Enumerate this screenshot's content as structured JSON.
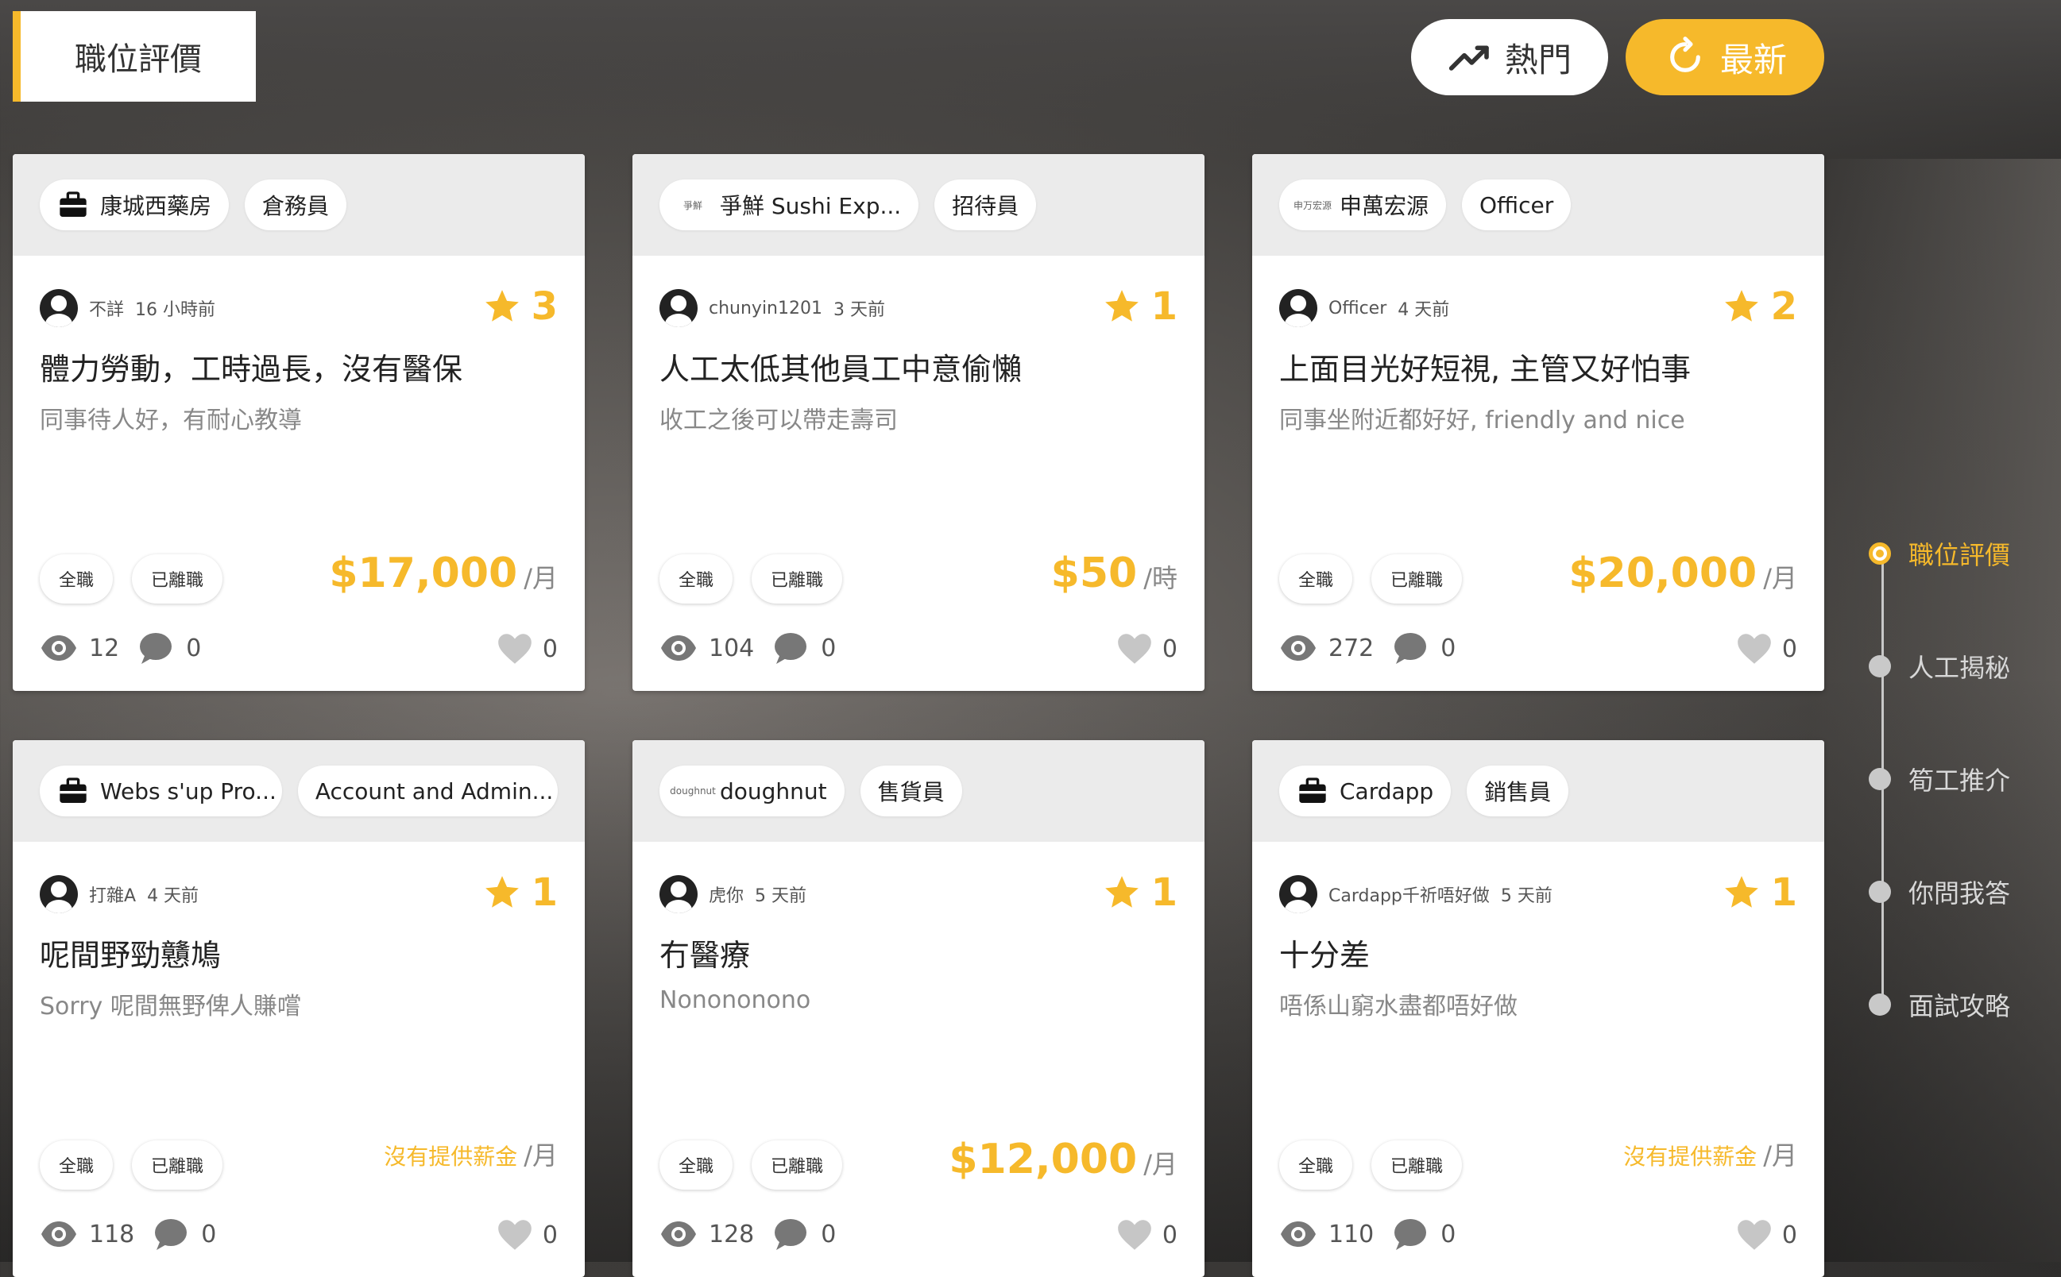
{
  "header": {
    "title": "職位評價"
  },
  "sort": {
    "hot_label": "熱門",
    "new_label": "最新"
  },
  "colors": {
    "accent": "#f6b92b"
  },
  "cards": [
    {
      "company": "康城西藥房",
      "company_icon": "briefcase-icon",
      "position": "倉務員",
      "author": "不詳",
      "time": "16 小時前",
      "rating": "3",
      "title": "體力勞動，工時過長，沒有醫保",
      "comment": "同事待人好，有耐心教導",
      "job_type": "全職",
      "status": "已離職",
      "salary": "$17,000",
      "unit": "/月",
      "views": "12",
      "comments": "0",
      "likes": "0"
    },
    {
      "company": "爭鮮 Sushi Exp...",
      "company_icon": "logo",
      "company_logo_text": "爭鮮",
      "position": "招待員",
      "author": "chunyin1201",
      "time": "3 天前",
      "rating": "1",
      "title": "人工太低其他員工中意偷懶",
      "comment": "收工之後可以帶走壽司",
      "job_type": "全職",
      "status": "已離職",
      "salary": "$50",
      "unit": "/時",
      "views": "104",
      "comments": "0",
      "likes": "0"
    },
    {
      "company": "申萬宏源",
      "company_icon": "logo",
      "company_logo_text": "申万宏源",
      "position": "Officer",
      "author": "Officer",
      "time": "4 天前",
      "rating": "2",
      "title": "上面目光好短視, 主管又好怕事",
      "comment": "同事坐附近都好好, friendly and nice",
      "job_type": "全職",
      "status": "已離職",
      "salary": "$20,000",
      "unit": "/月",
      "views": "272",
      "comments": "0",
      "likes": "0"
    },
    {
      "company": "Webs s'up Pro...",
      "company_icon": "briefcase-icon",
      "position": "Account and Admin...",
      "author": "打雜A",
      "time": "4 天前",
      "rating": "1",
      "title": "呢間野勁戇鳩",
      "comment": "Sorry 呢間無野俾人賺嚐",
      "job_type": "全職",
      "status": "已離職",
      "salary": "沒有提供薪金",
      "unit": "/月",
      "views": "118",
      "comments": "0",
      "likes": "0"
    },
    {
      "company": "doughnut",
      "company_icon": "logo",
      "company_logo_text": "doughnut",
      "position": "售貨員",
      "author": "虎你",
      "time": "5 天前",
      "rating": "1",
      "title": "冇醫療",
      "comment": "Nonononono",
      "job_type": "全職",
      "status": "已離職",
      "salary": "$12,000",
      "unit": "/月",
      "views": "128",
      "comments": "0",
      "likes": "0"
    },
    {
      "company": "Cardapp",
      "company_icon": "briefcase-icon",
      "position": "銷售員",
      "author": "Cardapp千祈唔好做",
      "time": "5 天前",
      "rating": "1",
      "title": "十分差",
      "comment": "唔係山窮水盡都唔好做",
      "job_type": "全職",
      "status": "已離職",
      "salary": "沒有提供薪金",
      "unit": "/月",
      "views": "110",
      "comments": "0",
      "likes": "0"
    }
  ],
  "timeline": [
    "職位評價",
    "人工揭秘",
    "筍工推介",
    "你問我答",
    "面試攻略"
  ]
}
